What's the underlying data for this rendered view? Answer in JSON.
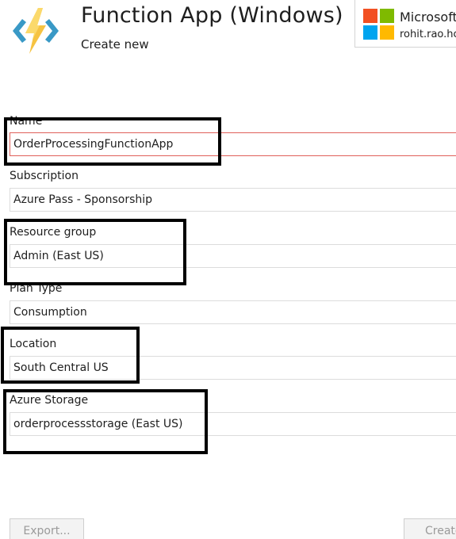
{
  "header": {
    "title": "Function App (Windows)",
    "subtitle": "Create new",
    "icon": "azure-functions-icon"
  },
  "account": {
    "company": "Microsoft",
    "email": "rohit.rao.hc",
    "icon": "microsoft-logo-icon"
  },
  "form": {
    "name": {
      "label": "Name",
      "value": "OrderProcessingFunctionApp"
    },
    "subscription": {
      "label": "Subscription",
      "value": "Azure Pass - Sponsorship"
    },
    "resource_group": {
      "label": "Resource group",
      "value": "Admin (East US)"
    },
    "plan_type": {
      "label": "Plan Type",
      "value": "Consumption"
    },
    "location": {
      "label": "Location",
      "value": "South Central US"
    },
    "storage": {
      "label": "Azure Storage",
      "value": "orderprocessstorage (East US)"
    }
  },
  "footer": {
    "export_label": "Export...",
    "create_label": "Create"
  },
  "colors": {
    "accent_yellow": "#f6c342",
    "accent_blue": "#3999c6",
    "error_border": "#e0605a",
    "ms_red": "#f25022",
    "ms_green": "#7fba00",
    "ms_blue": "#00a4ef",
    "ms_yellow": "#ffb900"
  }
}
